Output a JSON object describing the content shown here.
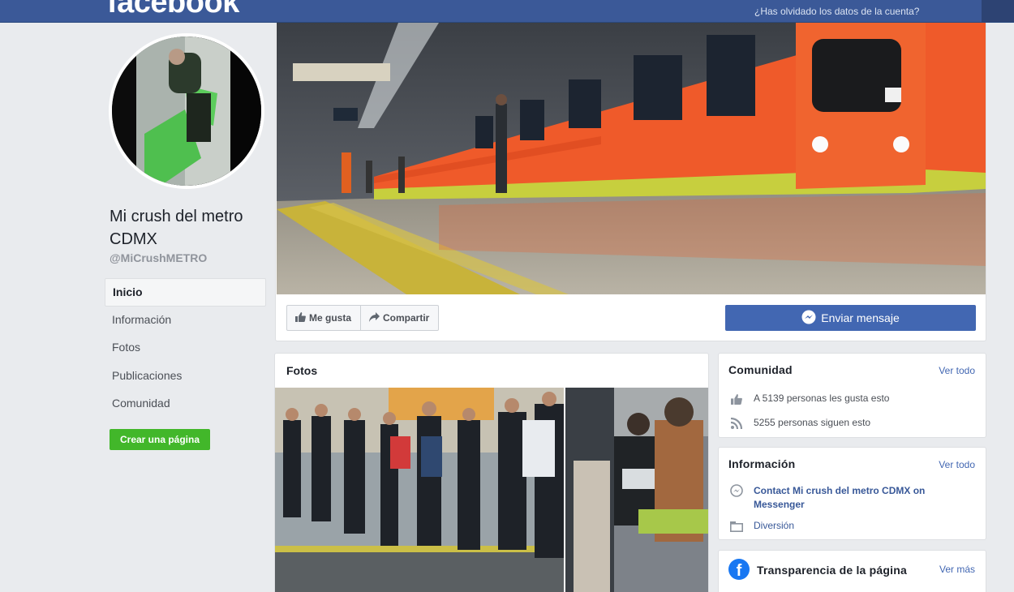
{
  "header": {
    "logo": "facebook",
    "forgot_link": "¿Has olvidado los datos de la cuenta?"
  },
  "profile": {
    "name": "Mi crush del metro CDMX",
    "handle": "@MiCrushMETRO"
  },
  "nav": {
    "items": [
      "Inicio",
      "Información",
      "Fotos",
      "Publicaciones",
      "Comunidad"
    ],
    "active": "Inicio"
  },
  "create_page_label": "Crear una página",
  "actions": {
    "like_label": "Me gusta",
    "share_label": "Compartir",
    "send_message_label": "Enviar mensaje"
  },
  "photos": {
    "title": "Fotos"
  },
  "community": {
    "title": "Comunidad",
    "see_all": "Ver todo",
    "likes_text": "A 5139 personas les gusta esto",
    "followers_text": "5255 personas siguen esto"
  },
  "info": {
    "title": "Información",
    "see_all": "Ver todo",
    "contact_text": "Contact Mi crush del metro CDMX on Messenger",
    "category": "Diversión"
  },
  "transparency": {
    "title": "Transparencia de la página",
    "see_more": "Ver más"
  },
  "colors": {
    "topbar": "#3b5998",
    "primary_button": "#4267b2",
    "create_button": "#42b72a",
    "link": "#385898",
    "background": "#e9ebee"
  }
}
